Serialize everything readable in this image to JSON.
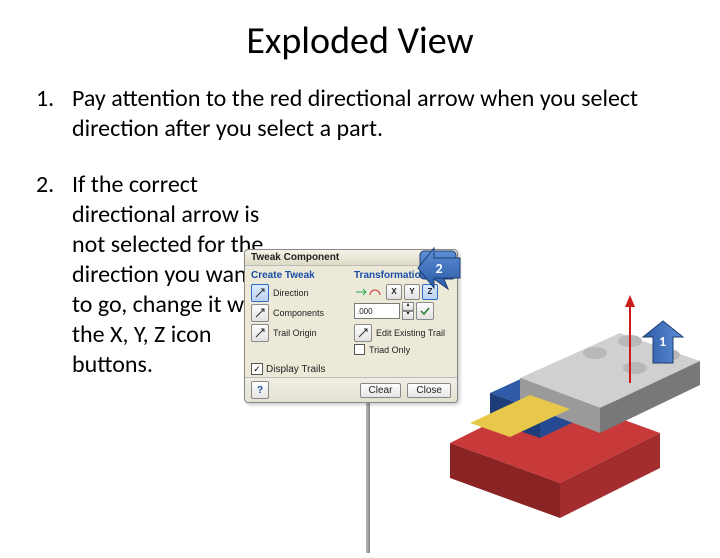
{
  "title": "Exploded View",
  "list": {
    "num1": "1.",
    "num2": "2.",
    "item1": "Pay attention to the red directional arrow when you select direction after you select a part.",
    "item2": "If the correct directional arrow is not selected for the direction you want to go, change it with the X, Y, Z icon buttons."
  },
  "dialog": {
    "title": "Tweak Component",
    "create_label": "Create Tweak",
    "transform_label": "Transformations",
    "direction": "Direction",
    "components": "Components",
    "trail_origin": "Trail Origin",
    "x": "X",
    "y": "Y",
    "z": "Z",
    "value": ".000",
    "edit_trail": "Edit Existing Trail",
    "triad_only": "Triad Only",
    "display_trails": "Display Trails",
    "checked": "✓",
    "help": "?",
    "clear": "Clear",
    "close": "Close"
  },
  "callouts": {
    "c1": "1",
    "c2": "2"
  }
}
